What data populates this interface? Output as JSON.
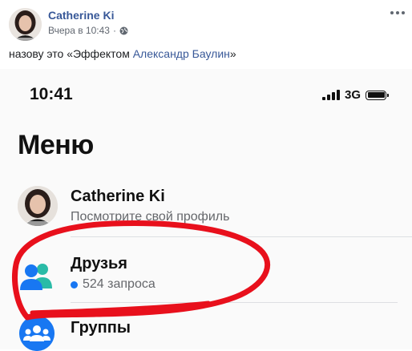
{
  "post": {
    "author": "Catherine Ki",
    "timestamp": "Вчера в 10:43",
    "separator": "·",
    "audience_icon": "globe-icon",
    "more_icon": "more-options-icon",
    "text_before": "назову это «Эффектом ",
    "mention": "Александр Баулин",
    "text_after": "»"
  },
  "screenshot": {
    "status_bar": {
      "time": "10:41",
      "network": "3G"
    },
    "menu_title": "Меню",
    "profile": {
      "name": "Catherine  Ki",
      "subtitle": "Посмотрите свой профиль"
    },
    "friends": {
      "title": "Друзья",
      "requests": "524 запроса",
      "icon": "friends-icon"
    },
    "groups": {
      "title": "Группы",
      "icon": "groups-icon"
    }
  },
  "colors": {
    "link": "#385898",
    "accent": "#1877f2",
    "annotation_stroke": "#e8101c",
    "friends_icon_teal": "#2abba7"
  }
}
